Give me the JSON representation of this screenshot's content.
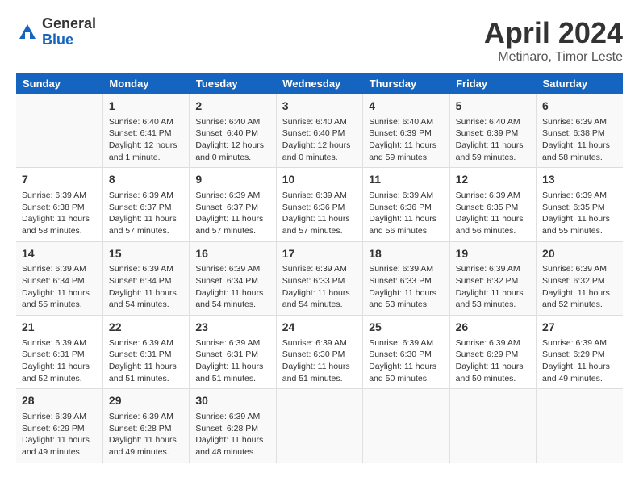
{
  "header": {
    "logo_general": "General",
    "logo_blue": "Blue",
    "title": "April 2024",
    "location": "Metinaro, Timor Leste"
  },
  "days_of_week": [
    "Sunday",
    "Monday",
    "Tuesday",
    "Wednesday",
    "Thursday",
    "Friday",
    "Saturday"
  ],
  "weeks": [
    [
      {
        "day": "",
        "info": ""
      },
      {
        "day": "1",
        "info": "Sunrise: 6:40 AM\nSunset: 6:41 PM\nDaylight: 12 hours\nand 1 minute."
      },
      {
        "day": "2",
        "info": "Sunrise: 6:40 AM\nSunset: 6:40 PM\nDaylight: 12 hours\nand 0 minutes."
      },
      {
        "day": "3",
        "info": "Sunrise: 6:40 AM\nSunset: 6:40 PM\nDaylight: 12 hours\nand 0 minutes."
      },
      {
        "day": "4",
        "info": "Sunrise: 6:40 AM\nSunset: 6:39 PM\nDaylight: 11 hours\nand 59 minutes."
      },
      {
        "day": "5",
        "info": "Sunrise: 6:40 AM\nSunset: 6:39 PM\nDaylight: 11 hours\nand 59 minutes."
      },
      {
        "day": "6",
        "info": "Sunrise: 6:39 AM\nSunset: 6:38 PM\nDaylight: 11 hours\nand 58 minutes."
      }
    ],
    [
      {
        "day": "7",
        "info": "Sunrise: 6:39 AM\nSunset: 6:38 PM\nDaylight: 11 hours\nand 58 minutes."
      },
      {
        "day": "8",
        "info": "Sunrise: 6:39 AM\nSunset: 6:37 PM\nDaylight: 11 hours\nand 57 minutes."
      },
      {
        "day": "9",
        "info": "Sunrise: 6:39 AM\nSunset: 6:37 PM\nDaylight: 11 hours\nand 57 minutes."
      },
      {
        "day": "10",
        "info": "Sunrise: 6:39 AM\nSunset: 6:36 PM\nDaylight: 11 hours\nand 57 minutes."
      },
      {
        "day": "11",
        "info": "Sunrise: 6:39 AM\nSunset: 6:36 PM\nDaylight: 11 hours\nand 56 minutes."
      },
      {
        "day": "12",
        "info": "Sunrise: 6:39 AM\nSunset: 6:35 PM\nDaylight: 11 hours\nand 56 minutes."
      },
      {
        "day": "13",
        "info": "Sunrise: 6:39 AM\nSunset: 6:35 PM\nDaylight: 11 hours\nand 55 minutes."
      }
    ],
    [
      {
        "day": "14",
        "info": "Sunrise: 6:39 AM\nSunset: 6:34 PM\nDaylight: 11 hours\nand 55 minutes."
      },
      {
        "day": "15",
        "info": "Sunrise: 6:39 AM\nSunset: 6:34 PM\nDaylight: 11 hours\nand 54 minutes."
      },
      {
        "day": "16",
        "info": "Sunrise: 6:39 AM\nSunset: 6:34 PM\nDaylight: 11 hours\nand 54 minutes."
      },
      {
        "day": "17",
        "info": "Sunrise: 6:39 AM\nSunset: 6:33 PM\nDaylight: 11 hours\nand 54 minutes."
      },
      {
        "day": "18",
        "info": "Sunrise: 6:39 AM\nSunset: 6:33 PM\nDaylight: 11 hours\nand 53 minutes."
      },
      {
        "day": "19",
        "info": "Sunrise: 6:39 AM\nSunset: 6:32 PM\nDaylight: 11 hours\nand 53 minutes."
      },
      {
        "day": "20",
        "info": "Sunrise: 6:39 AM\nSunset: 6:32 PM\nDaylight: 11 hours\nand 52 minutes."
      }
    ],
    [
      {
        "day": "21",
        "info": "Sunrise: 6:39 AM\nSunset: 6:31 PM\nDaylight: 11 hours\nand 52 minutes."
      },
      {
        "day": "22",
        "info": "Sunrise: 6:39 AM\nSunset: 6:31 PM\nDaylight: 11 hours\nand 51 minutes."
      },
      {
        "day": "23",
        "info": "Sunrise: 6:39 AM\nSunset: 6:31 PM\nDaylight: 11 hours\nand 51 minutes."
      },
      {
        "day": "24",
        "info": "Sunrise: 6:39 AM\nSunset: 6:30 PM\nDaylight: 11 hours\nand 51 minutes."
      },
      {
        "day": "25",
        "info": "Sunrise: 6:39 AM\nSunset: 6:30 PM\nDaylight: 11 hours\nand 50 minutes."
      },
      {
        "day": "26",
        "info": "Sunrise: 6:39 AM\nSunset: 6:29 PM\nDaylight: 11 hours\nand 50 minutes."
      },
      {
        "day": "27",
        "info": "Sunrise: 6:39 AM\nSunset: 6:29 PM\nDaylight: 11 hours\nand 49 minutes."
      }
    ],
    [
      {
        "day": "28",
        "info": "Sunrise: 6:39 AM\nSunset: 6:29 PM\nDaylight: 11 hours\nand 49 minutes."
      },
      {
        "day": "29",
        "info": "Sunrise: 6:39 AM\nSunset: 6:28 PM\nDaylight: 11 hours\nand 49 minutes."
      },
      {
        "day": "30",
        "info": "Sunrise: 6:39 AM\nSunset: 6:28 PM\nDaylight: 11 hours\nand 48 minutes."
      },
      {
        "day": "",
        "info": ""
      },
      {
        "day": "",
        "info": ""
      },
      {
        "day": "",
        "info": ""
      },
      {
        "day": "",
        "info": ""
      }
    ]
  ]
}
